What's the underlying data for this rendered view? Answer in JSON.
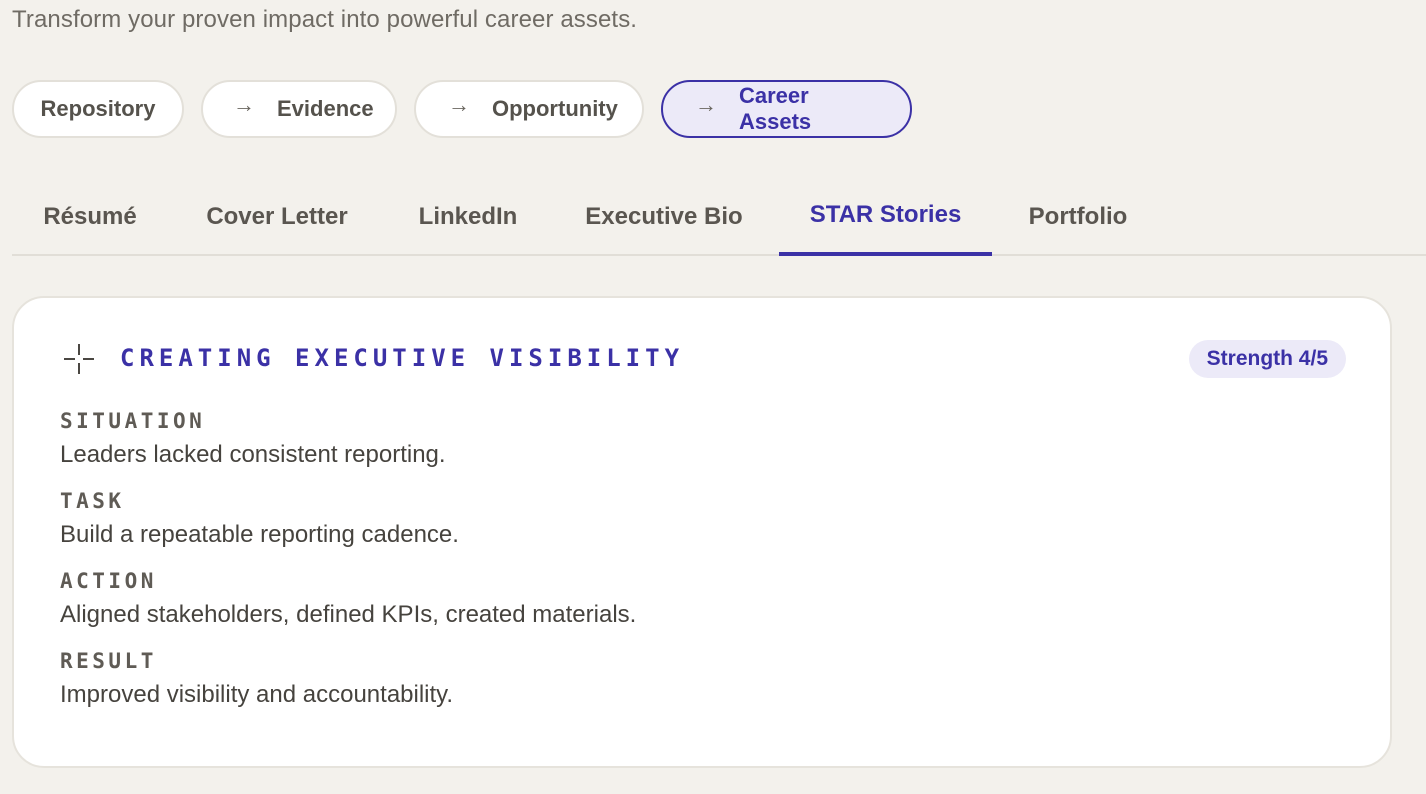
{
  "header": {
    "subtitle": "Transform your proven impact into powerful career assets."
  },
  "pipeline": {
    "steps": [
      {
        "label": "Repository",
        "arrow": ""
      },
      {
        "label": "Evidence",
        "arrow": "→"
      },
      {
        "label": "Opportunity",
        "arrow": "→"
      },
      {
        "label": "Career Assets",
        "arrow": "→",
        "active": true
      }
    ]
  },
  "tabs": [
    {
      "label": "Résumé"
    },
    {
      "label": "Cover Letter"
    },
    {
      "label": "LinkedIn"
    },
    {
      "label": "Executive Bio"
    },
    {
      "label": "STAR Stories",
      "active": true
    },
    {
      "label": "Portfolio"
    }
  ],
  "story": {
    "icon": "sparkle-cross-icon",
    "title": "CREATING EXECUTIVE VISIBILITY",
    "badge": "Strength 4/5",
    "sections": [
      {
        "label": "SITUATION",
        "text": "Leaders lacked consistent reporting."
      },
      {
        "label": "TASK",
        "text": "Build a repeatable reporting cadence."
      },
      {
        "label": "ACTION",
        "text": "Aligned stakeholders, defined KPIs, created materials."
      },
      {
        "label": "RESULT",
        "text": "Improved visibility and accountability."
      }
    ]
  },
  "colors": {
    "accent": "#3b31a6",
    "accent_bg": "#eceaf8",
    "page_bg": "#f3f1ec"
  }
}
